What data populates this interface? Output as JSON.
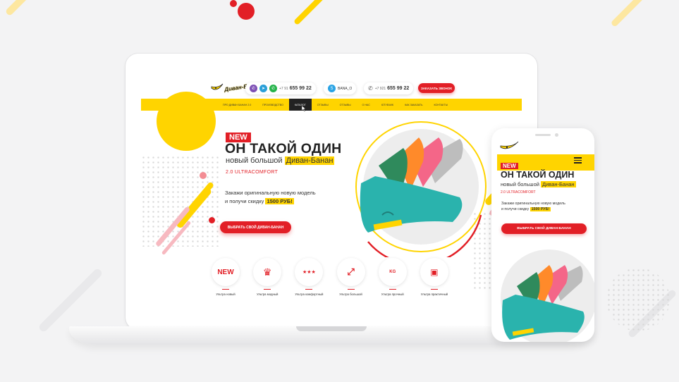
{
  "brand": {
    "logo_text": "Диван-Банан",
    "accent": "#e21f26",
    "yellow": "#ffd400"
  },
  "header": {
    "contacts": [
      {
        "icon": "viber-icon"
      },
      {
        "icon": "telegram-icon"
      },
      {
        "icon": "whatsapp-icon"
      }
    ],
    "phone_prefix_1": "+7 91",
    "phone_main_1": "655 99 22",
    "skype_icon": "skype-icon",
    "skype_name": "BANA_O",
    "phone_prefix_2": "+7 921",
    "phone_main_2": "655 99 22",
    "call_button": "Заказать звонок"
  },
  "nav": {
    "items": [
      "Про диван банан 2.0",
      "Производство",
      "Каталог",
      "Отзывы",
      "Отзывы",
      "О нас",
      "Ютубчик",
      "Как заказать",
      "Контакты"
    ],
    "active_index": 2
  },
  "hero": {
    "badge": "NEW",
    "title": "ОН ТАКОЙ ОДИН",
    "subtitle_prefix": "новый большой",
    "subtitle_highlight": "Диван-Банан",
    "tagline": "2.0 ULTRACOMFORT",
    "offer_line1": "Закажи оригинальную новую модель",
    "offer_line2_prefix": "и получи скидку",
    "offer_discount": "1500 РУБ!",
    "cta": "Выбрать свой Диван-Банан"
  },
  "features": [
    {
      "icon_text": "NEW",
      "label": "Ультра новый"
    },
    {
      "icon_text": "♛",
      "label": "Ультра модный"
    },
    {
      "icon_text": "★★★",
      "label": "Ультра комфортный"
    },
    {
      "icon_text": "⤢",
      "label": "Ультра большой"
    },
    {
      "icon_text": "KG",
      "label": "Ультра прочный"
    },
    {
      "icon_text": "▣",
      "label": "Ультра практичный"
    }
  ],
  "mobile": {
    "badge": "NEW",
    "title": "ОН ТАКОЙ ОДИН",
    "subtitle_prefix": "новый большой",
    "subtitle_highlight": "Диван-Банан",
    "tagline": "2.0 ULTRACOMFORT",
    "offer_line1": "Закажи оригинальную новую модель",
    "offer_line2_prefix": "и получи скидку",
    "offer_discount": "1500 РУБ!",
    "cta": "ВЫБРАТЬ СВОЙ ДИВАН-БАНАН"
  },
  "product": {
    "colors": [
      "#2aa6a0",
      "#2f8a5c",
      "#ff8a2a",
      "#f46688",
      "#9e9e9e",
      "#bfbfbf"
    ]
  }
}
